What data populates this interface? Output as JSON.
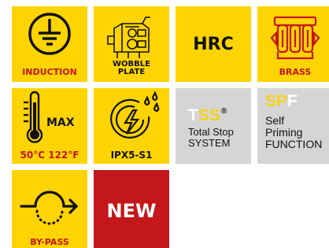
{
  "colors": {
    "tile_yellow": "#ffd400",
    "tile_gray": "#d5d5d5",
    "tile_red": "#c3171b",
    "text_red": "#c3171b",
    "icon_dark": "#111111",
    "logo_yellow": "#f5d21a"
  },
  "tiles": {
    "induction": {
      "label": "INDUCTION",
      "icon": "ground-symbol-icon"
    },
    "wobble_plate": {
      "label_line1": "WOBBLE",
      "label_line2": "PLATE",
      "icon": "pump-head-icon"
    },
    "hrc": {
      "text": "HRC"
    },
    "brass": {
      "label": "BRASS",
      "icon": "brass-manifold-icon"
    },
    "max_temp": {
      "max_label": "MAX",
      "temperature": "50°C 122°F",
      "icon": "thermometer-icon"
    },
    "ipx5": {
      "label": "IPX5-S1",
      "icon": "water-protection-icon"
    },
    "tss": {
      "logo_t": "T",
      "logo_ss": "SS",
      "mark": "®",
      "line1": "Total Stop",
      "line2": "SYSTEM"
    },
    "spf": {
      "logo_s": "S",
      "logo_p": "P",
      "logo_f": "F",
      "line1": "Self",
      "line2": "Priming",
      "line3": "FUNCTION"
    },
    "bypass": {
      "label": "BY-PASS",
      "icon": "bypass-arrow-icon"
    },
    "new": {
      "text": "NEW"
    }
  }
}
